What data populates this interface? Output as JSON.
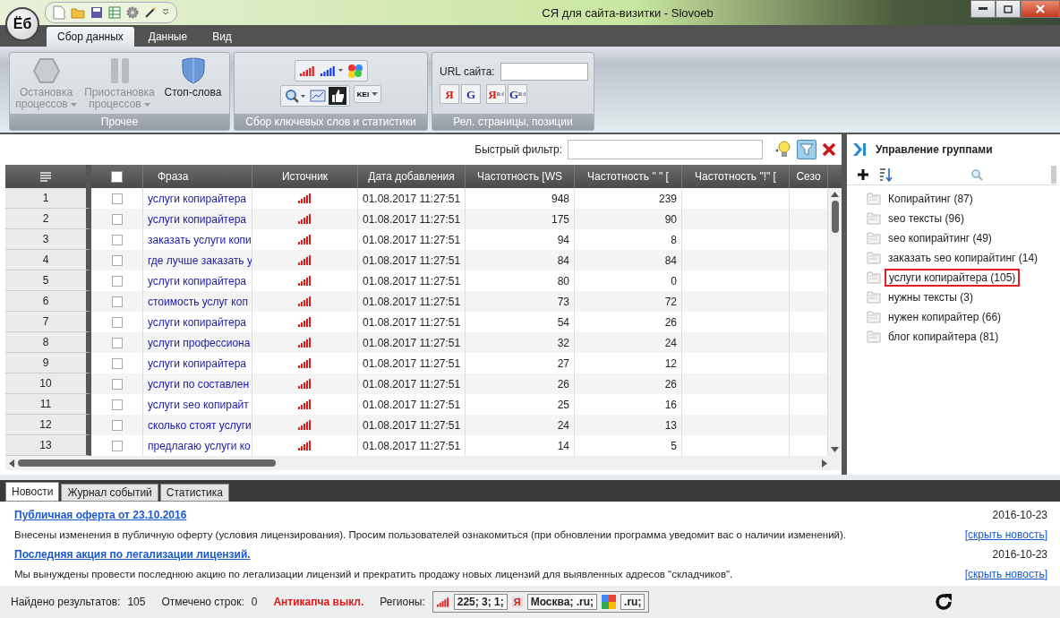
{
  "window": {
    "title": "СЯ для сайта-визитки - Slovoeb",
    "logo": "Ёб"
  },
  "ribbon_tabs": [
    {
      "label": "Сбор данных",
      "selected": true
    },
    {
      "label": "Данные",
      "selected": false
    },
    {
      "label": "Вид",
      "selected": false
    }
  ],
  "ribbon": {
    "process_group": {
      "name": "Прочее",
      "buttons": [
        {
          "kind": "stop",
          "label": "Остановка процессов",
          "disabled": true,
          "has_menu": true
        },
        {
          "kind": "pause",
          "label": "Приостановка процессов",
          "disabled": true,
          "has_menu": true
        },
        {
          "kind": "shield",
          "label": "Стоп-слова",
          "disabled": false,
          "has_menu": false
        }
      ]
    },
    "keywords_group": {
      "name": "Сбор ключевых слов и статистики",
      "kei_label": "KEI"
    },
    "positions_group": {
      "name": "Рел. страницы, позиции",
      "url_label": "URL сайта:",
      "engines": [
        {
          "label": "Я"
        },
        {
          "label": "G"
        },
        {
          "label": "Я",
          "sub": "R:l"
        },
        {
          "label": "G",
          "sub": "R:l"
        }
      ]
    }
  },
  "filter": {
    "label": "Быстрый фильтр:"
  },
  "table": {
    "columns": [
      "Фраза",
      "Источник",
      "Дата добавления",
      "Частотность [WS",
      "Частотность \" \" [",
      "Частотность \"!\" [",
      "Сезо"
    ],
    "select_all_checked": false,
    "rows": [
      {
        "num": "1",
        "checked": false,
        "phrase": "услуги копирайтера",
        "date": "01.08.2017 11:27:51",
        "ws": "948",
        "quoted": "239"
      },
      {
        "num": "2",
        "checked": false,
        "phrase": "услуги копирайтера",
        "date": "01.08.2017 11:27:51",
        "ws": "175",
        "quoted": "90"
      },
      {
        "num": "3",
        "checked": false,
        "phrase": "заказать услуги копи",
        "date": "01.08.2017 11:27:51",
        "ws": "94",
        "quoted": "8"
      },
      {
        "num": "4",
        "checked": false,
        "phrase": "где лучше заказать у",
        "date": "01.08.2017 11:27:51",
        "ws": "84",
        "quoted": "84"
      },
      {
        "num": "5",
        "checked": false,
        "phrase": "услуги копирайтера",
        "date": "01.08.2017 11:27:51",
        "ws": "80",
        "quoted": "0"
      },
      {
        "num": "6",
        "checked": false,
        "phrase": "стоимость услуг коп",
        "date": "01.08.2017 11:27:51",
        "ws": "73",
        "quoted": "72"
      },
      {
        "num": "7",
        "checked": false,
        "phrase": "услуги копирайтера",
        "date": "01.08.2017 11:27:51",
        "ws": "54",
        "quoted": "26"
      },
      {
        "num": "8",
        "checked": false,
        "phrase": "услуги профессиона",
        "date": "01.08.2017 11:27:51",
        "ws": "32",
        "quoted": "24"
      },
      {
        "num": "9",
        "checked": false,
        "phrase": "услуги копирайтера",
        "date": "01.08.2017 11:27:51",
        "ws": "27",
        "quoted": "12"
      },
      {
        "num": "10",
        "checked": false,
        "phrase": "услуги по составлен",
        "date": "01.08.2017 11:27:51",
        "ws": "26",
        "quoted": "26"
      },
      {
        "num": "11",
        "checked": false,
        "phrase": "услуги seo копирайт",
        "date": "01.08.2017 11:27:51",
        "ws": "25",
        "quoted": "16"
      },
      {
        "num": "12",
        "checked": false,
        "phrase": "сколько стоят услуги",
        "date": "01.08.2017 11:27:51",
        "ws": "24",
        "quoted": "13"
      },
      {
        "num": "13",
        "checked": false,
        "phrase": "предлагаю услуги ко",
        "date": "01.08.2017 11:27:51",
        "ws": "14",
        "quoted": "5"
      }
    ]
  },
  "groups_panel": {
    "title": "Управление группами",
    "groups": [
      {
        "label": "Копирайтинг (87)",
        "selected": false
      },
      {
        "label": "seo тексты (96)",
        "selected": false
      },
      {
        "label": "seo копирайтинг (49)",
        "selected": false
      },
      {
        "label": "заказать seo копирайтинг (14)",
        "selected": false
      },
      {
        "label": "услуги копирайтера (105)",
        "selected": true
      },
      {
        "label": "нужны тексты (3)",
        "selected": false
      },
      {
        "label": "нужен копирайтер (66)",
        "selected": false
      },
      {
        "label": "блог копирайтера (81)",
        "selected": false
      }
    ]
  },
  "bottom_tabs": [
    {
      "label": "Новости",
      "selected": true
    },
    {
      "label": "Журнал событий",
      "selected": false
    },
    {
      "label": "Статистика",
      "selected": false
    }
  ],
  "news": [
    {
      "title": "Публичная оферта от 23.10.2016",
      "date": "2016-10-23",
      "body": "Внесены изменения в публичную оферту (условия лицензирования). Просим пользователей ознакомиться (при обновлении программа уведомит вас о наличии изменений).",
      "hide": "[скрыть новость]"
    },
    {
      "title": "Последняя акция по легализации лицензий.",
      "date": "2016-10-23",
      "body": "Мы вынуждены провести последнюю акцию по легализации лицензий и прекратить продажу новых лицензий для выявленных адресов \"складчиков\".",
      "hide": "[скрыть новость]"
    }
  ],
  "status_bar": {
    "found_label": "Найдено результатов:",
    "found": "105",
    "marked_label": "Отмечено строк:",
    "marked": "0",
    "anticaptcha": "Антикапча выкл.",
    "regions_label": "Регионы:",
    "regions": [
      {
        "kind": "wordstat",
        "text": "225; 3; 1;"
      },
      {
        "kind": "yandex",
        "icon_text": "Я",
        "text": "Москва; .ru;"
      },
      {
        "kind": "google",
        "text": ".ru;"
      }
    ]
  }
}
